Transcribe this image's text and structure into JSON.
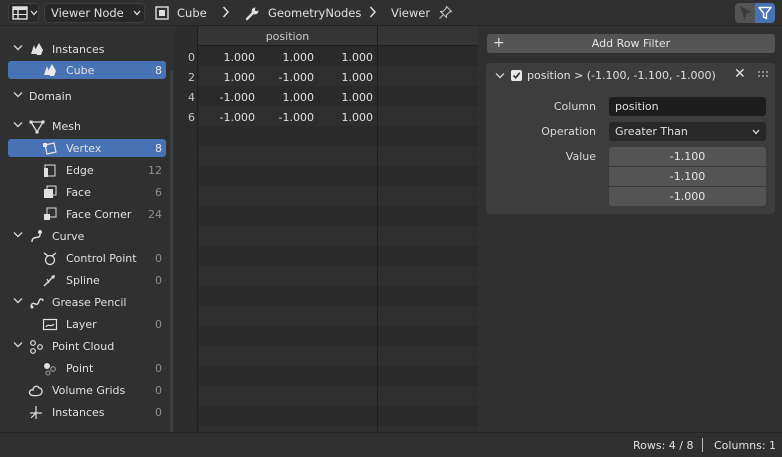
{
  "header": {
    "editor_type_icon": "spreadsheet-icon",
    "viewer_dropdown": "Viewer Node",
    "breadcrumb": [
      {
        "icon": "object-cube-icon",
        "label": "Cube"
      },
      {
        "icon": "wrench-icon",
        "label": "GeometryNodes"
      },
      {
        "icon": "",
        "label": "Viewer"
      }
    ]
  },
  "tree": {
    "items": [
      {
        "label": "Instances",
        "count": "",
        "type": "header",
        "icon": "instances-icon"
      },
      {
        "label": "Cube",
        "count": "8",
        "type": "child",
        "selected": true,
        "icon": "cube-icon"
      },
      {
        "label": "Domain",
        "count": "",
        "type": "section"
      },
      {
        "label": "Mesh",
        "count": "",
        "type": "header",
        "icon": "mesh-icon"
      },
      {
        "label": "Vertex",
        "count": "8",
        "type": "child",
        "selected": true,
        "icon": "vertex-icon"
      },
      {
        "label": "Edge",
        "count": "12",
        "type": "child",
        "icon": "edge-icon"
      },
      {
        "label": "Face",
        "count": "6",
        "type": "child",
        "icon": "face-icon"
      },
      {
        "label": "Face Corner",
        "count": "24",
        "type": "child",
        "icon": "face-corner-icon"
      },
      {
        "label": "Curve",
        "count": "",
        "type": "header",
        "icon": "curve-icon"
      },
      {
        "label": "Control Point",
        "count": "0",
        "type": "child",
        "icon": "control-point-icon"
      },
      {
        "label": "Spline",
        "count": "0",
        "type": "child",
        "icon": "spline-icon"
      },
      {
        "label": "Grease Pencil",
        "count": "",
        "type": "header",
        "icon": "grease-pencil-icon"
      },
      {
        "label": "Layer",
        "count": "0",
        "type": "child",
        "icon": "layer-icon"
      },
      {
        "label": "Point Cloud",
        "count": "",
        "type": "header",
        "icon": "point-cloud-icon"
      },
      {
        "label": "Point",
        "count": "0",
        "type": "child",
        "icon": "point-icon"
      },
      {
        "label": "Volume Grids",
        "count": "0",
        "type": "leaf",
        "icon": "volume-icon"
      },
      {
        "label": "Instances",
        "count": "0",
        "type": "leaf",
        "icon": "instances-empty-icon"
      }
    ]
  },
  "sheet": {
    "column_header": "position",
    "rows": [
      {
        "index": "0",
        "values": [
          "1.000",
          "1.000",
          "1.000"
        ]
      },
      {
        "index": "2",
        "values": [
          "1.000",
          "-1.000",
          "1.000"
        ]
      },
      {
        "index": "4",
        "values": [
          "-1.000",
          "1.000",
          "1.000"
        ]
      },
      {
        "index": "6",
        "values": [
          "-1.000",
          "-1.000",
          "1.000"
        ]
      }
    ]
  },
  "filters": {
    "add_button": "Add Row Filter",
    "filter": {
      "title": "position > (-1.100, -1.100, -1.000)",
      "column_label": "Column",
      "column_value": "position",
      "operation_label": "Operation",
      "operation_value": "Greater Than",
      "value_label": "Value",
      "values": [
        "-1.100",
        "-1.100",
        "-1.000"
      ]
    }
  },
  "footer": {
    "rows": "Rows: 4 / 8",
    "columns": "Columns: 1"
  },
  "colors": {
    "selection": "#4772b3",
    "background": "#303030",
    "filter_toggle": "#4772b3"
  }
}
